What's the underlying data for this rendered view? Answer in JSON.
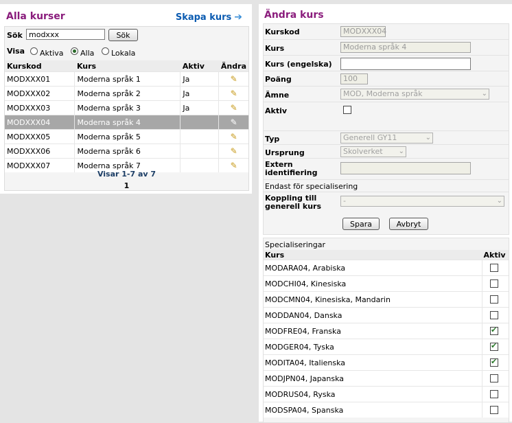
{
  "left": {
    "title": "Alla kurser",
    "create_label": "Skapa kurs",
    "search": {
      "label": "Sök",
      "value": "modxxx",
      "button": "Sök"
    },
    "filter": {
      "label": "Visa",
      "options": [
        "Aktiva",
        "Alla",
        "Lokala"
      ],
      "selected": "Alla"
    },
    "columns": [
      "Kurskod",
      "Kurs",
      "Aktiv",
      "Ändra"
    ],
    "rows": [
      {
        "code": "MODXXX01",
        "name": "Moderna språk 1",
        "active": "Ja"
      },
      {
        "code": "MODXXX02",
        "name": "Moderna språk 2",
        "active": "Ja"
      },
      {
        "code": "MODXXX03",
        "name": "Moderna språk 3",
        "active": "Ja"
      },
      {
        "code": "MODXXX04",
        "name": "Moderna språk 4",
        "active": ""
      },
      {
        "code": "MODXXX05",
        "name": "Moderna språk 5",
        "active": ""
      },
      {
        "code": "MODXXX06",
        "name": "Moderna språk 6",
        "active": ""
      },
      {
        "code": "MODXXX07",
        "name": "Moderna språk 7",
        "active": ""
      }
    ],
    "selected_row": 3,
    "pager_text": "Visar 1-7 av 7",
    "page": "1"
  },
  "right": {
    "title": "Ändra kurs",
    "fields": {
      "kurskod": {
        "label": "Kurskod",
        "value": "MODXXX04"
      },
      "kurs": {
        "label": "Kurs",
        "value": "Moderna språk 4"
      },
      "kurs_en": {
        "label": "Kurs (engelska)",
        "value": ""
      },
      "poang": {
        "label": "Poäng",
        "value": "100"
      },
      "amne": {
        "label": "Ämne",
        "value": "MOD, Moderna språk"
      },
      "aktiv": {
        "label": "Aktiv",
        "checked": false
      },
      "typ": {
        "label": "Typ",
        "value": "Generell GY11"
      },
      "ursprung": {
        "label": "Ursprung",
        "value": "Skolverket"
      },
      "extern": {
        "label": "Extern identifiering",
        "value": ""
      },
      "special_note": "Endast för specialisering",
      "koppling": {
        "label": "Koppling till generell kurs",
        "value": "-"
      }
    },
    "save_label": "Spara",
    "cancel_label": "Avbryt"
  },
  "specializations": {
    "title": "Specialiseringar",
    "columns": [
      "Kurs",
      "Aktiv"
    ],
    "items": [
      {
        "name": "MODARA04, Arabiska",
        "active": false
      },
      {
        "name": "MODCHI04, Kinesiska",
        "active": false
      },
      {
        "name": "MODCMN04, Kinesiska, Mandarin",
        "active": false
      },
      {
        "name": "MODDAN04, Danska",
        "active": false
      },
      {
        "name": "MODFRE04, Franska",
        "active": true
      },
      {
        "name": "MODGER04, Tyska",
        "active": true
      },
      {
        "name": "MODITA04, Italienska",
        "active": true
      },
      {
        "name": "MODJPN04, Japanska",
        "active": false
      },
      {
        "name": "MODRUS04, Ryska",
        "active": false
      },
      {
        "name": "MODSPA04, Spanska",
        "active": false
      }
    ]
  }
}
